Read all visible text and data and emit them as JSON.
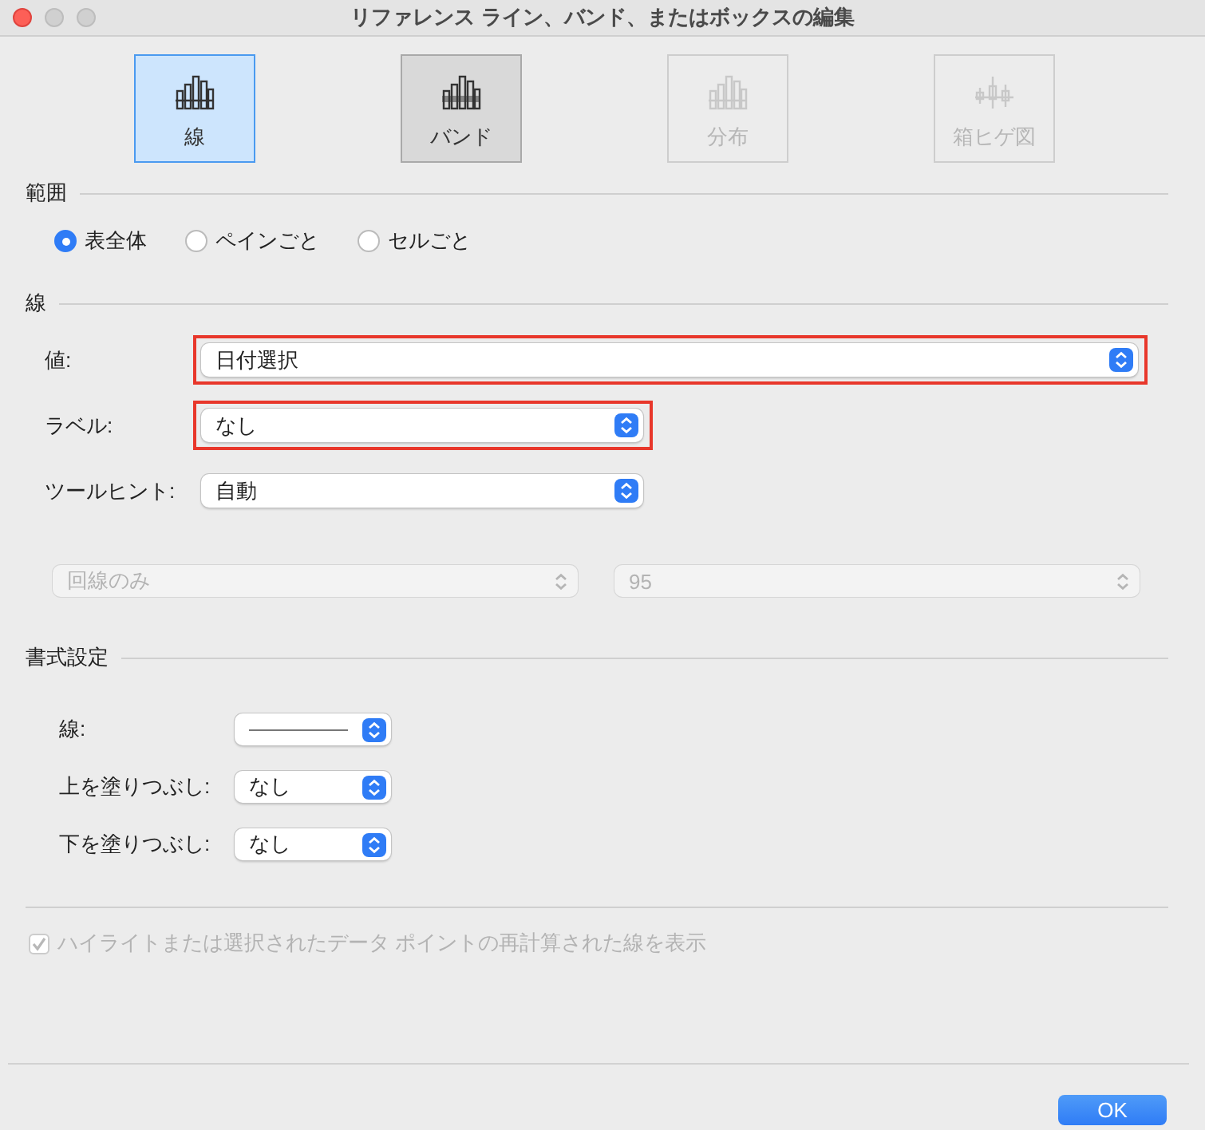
{
  "window": {
    "title": "リファレンス ライン、バンド、またはボックスの編集"
  },
  "types": [
    {
      "label": "線",
      "selected": true,
      "pressed": false,
      "disabled": false
    },
    {
      "label": "バンド",
      "selected": false,
      "pressed": true,
      "disabled": false
    },
    {
      "label": "分布",
      "selected": false,
      "pressed": false,
      "disabled": true
    },
    {
      "label": "箱ヒゲ図",
      "selected": false,
      "pressed": false,
      "disabled": true
    }
  ],
  "scope": {
    "title": "範囲",
    "options": [
      {
        "label": "表全体",
        "selected": true
      },
      {
        "label": "ペインごと",
        "selected": false
      },
      {
        "label": "セルごと",
        "selected": false
      }
    ]
  },
  "line": {
    "title": "線",
    "fields": [
      {
        "label": "値:",
        "value": "日付選択",
        "kind": "wide",
        "highlighted": true
      },
      {
        "label": "ラベル:",
        "value": "なし",
        "kind": "medium",
        "highlighted": true
      },
      {
        "label": "ツールヒント:",
        "value": "自動",
        "kind": "medium",
        "highlighted": false
      }
    ],
    "extra": [
      {
        "value": "回線のみ",
        "disabled": true
      },
      {
        "value": "95",
        "disabled": true
      }
    ]
  },
  "format": {
    "title": "書式設定",
    "fields": [
      {
        "label": "線:",
        "kind": "line-style"
      },
      {
        "label": "上を塗りつぶし:",
        "kind": "text",
        "value": "なし"
      },
      {
        "label": "下を塗りつぶし:",
        "kind": "text",
        "value": "なし"
      }
    ]
  },
  "recalc": {
    "label": "ハイライトまたは選択されたデータ ポイントの再計算された線を表示",
    "checked": true,
    "disabled": true
  },
  "ok": {
    "label": "OK"
  }
}
